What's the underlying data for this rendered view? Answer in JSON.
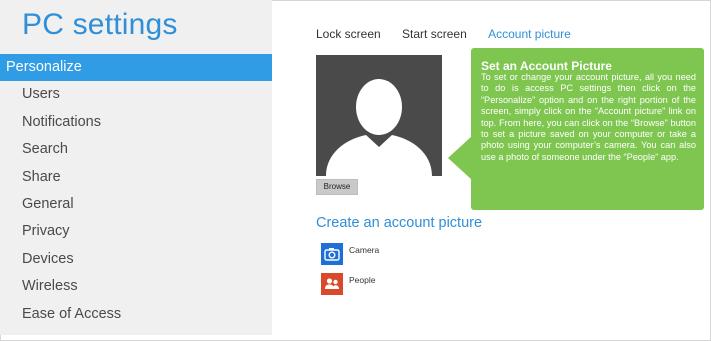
{
  "sidebar": {
    "title": "PC settings",
    "items": [
      {
        "label": "Personalize",
        "active": true
      },
      {
        "label": "Users"
      },
      {
        "label": "Notifications"
      },
      {
        "label": "Search"
      },
      {
        "label": "Share"
      },
      {
        "label": "General"
      },
      {
        "label": "Privacy"
      },
      {
        "label": "Devices"
      },
      {
        "label": "Wireless"
      },
      {
        "label": "Ease of Access"
      }
    ]
  },
  "tabs": [
    {
      "label": "Lock screen"
    },
    {
      "label": "Start screen"
    },
    {
      "label": "Account picture",
      "active": true
    }
  ],
  "account_picture": {
    "avatar_icon": "user-silhouette-icon",
    "browse_label": "Browse"
  },
  "callout": {
    "title": "Set an Account Picture",
    "body": "To set or change your account picture, all you need to do is access PC settings then click on the “Personalize” option and on the right portion of the screen, simply click on the “Account picture” link on top. From here, you can click on the “Browse” button to set a picture saved on your computer or take a photo using your computer’s camera. You can also use a photo of someone under the “People” app."
  },
  "create": {
    "heading": "Create an account picture",
    "options": [
      {
        "label": "Camera",
        "icon": "camera-icon",
        "color": "#1e6fd9"
      },
      {
        "label": "People",
        "icon": "people-icon",
        "color": "#d94a2b"
      }
    ]
  },
  "colors": {
    "accent": "#2f8fd8",
    "sidebar_bg": "#f0f0f0",
    "selected_bg": "#2f9ce5",
    "callout_bg": "#7ec64f"
  }
}
